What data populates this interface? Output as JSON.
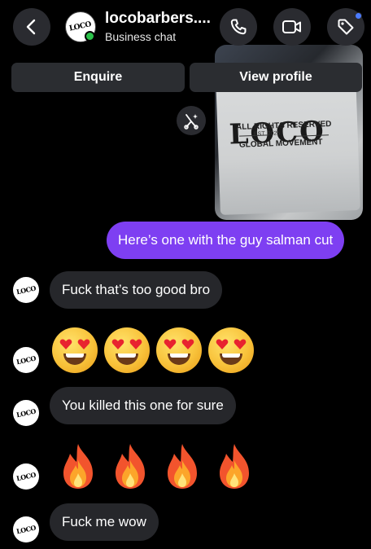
{
  "header": {
    "title": "locobarbers....",
    "subtitle": "Business chat",
    "avatar_text": "LOCO"
  },
  "actions": {
    "enquire_label": "Enquire",
    "view_profile_label": "View profile"
  },
  "photo": {
    "shirt_logo": "LOCO",
    "line1": "ALL RIGHTS RESERVED",
    "line2": "EST. 2025",
    "line3": "GLOBAL MOVEMENT"
  },
  "messages": [
    {
      "from": "me",
      "text": "Here’s one with the guy salman cut"
    },
    {
      "from": "them",
      "text": "Fuck that’s too good bro"
    },
    {
      "from": "them",
      "emoji": "heart-eyes",
      "count": 4
    },
    {
      "from": "them",
      "text": "You killed this one for sure"
    },
    {
      "from": "them",
      "emoji": "fire",
      "count": 4
    },
    {
      "from": "them",
      "text": "Fuck me wow"
    }
  ],
  "colors": {
    "background": "#000000",
    "outgoing_bubble": "#7e3ff2",
    "incoming_bubble": "#26272b",
    "button_bg": "#2a2b30",
    "online": "#2bc24a",
    "notification_dot": "#4b7bff"
  },
  "icons": [
    "chevron-left-icon",
    "phone-icon",
    "video-icon",
    "tag-icon",
    "reply-sparkle-icon"
  ]
}
